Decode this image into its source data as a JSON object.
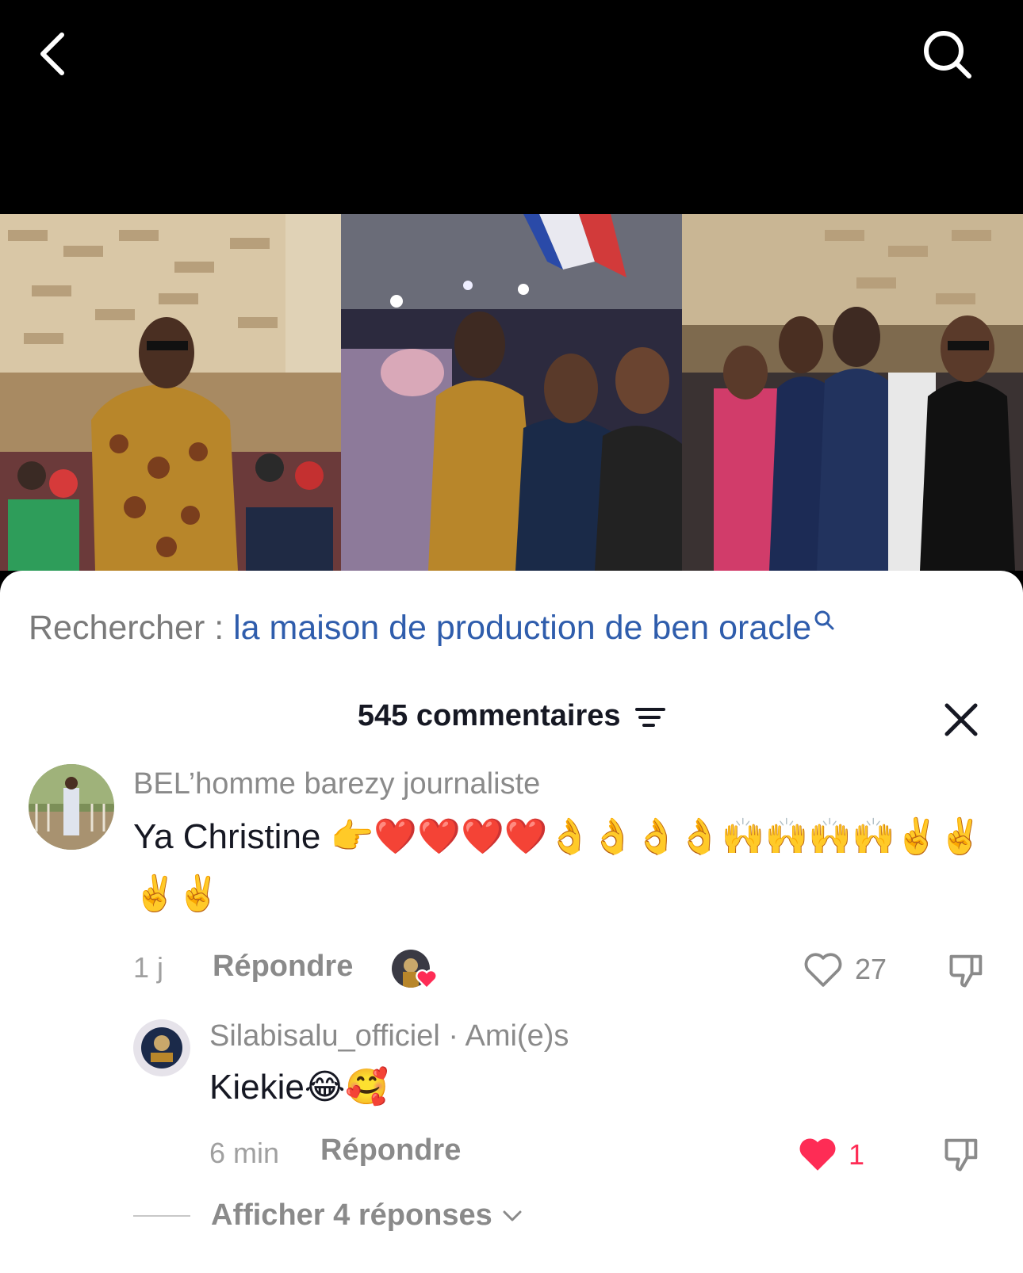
{
  "search_suggestion": {
    "prefix": "Rechercher :",
    "query": "la maison de production de ben oracle"
  },
  "comments_header": {
    "title": "545 commentaires"
  },
  "comments": [
    {
      "username": "BEL’homme barezy journaliste",
      "text": "Ya Christine 👉❤️❤️❤️❤️👌👌👌👌🙌🙌🙌🙌✌️✌️✌️✌️",
      "time": "1 j",
      "reply_label": "Répondre",
      "likes": "27",
      "liked": false
    }
  ],
  "replies": [
    {
      "username": "Silabisalu_officiel",
      "tag": "· Ami(e)s",
      "text": "Kiekie😂🥰",
      "time": "6 min",
      "reply_label": "Répondre",
      "likes": "1",
      "liked": true
    }
  ],
  "view_more_replies": "Afficher 4 réponses",
  "colors": {
    "link_blue": "#2f5dac",
    "like_red": "#fe2c55",
    "text_dark": "#161823",
    "text_grey": "#8a8a8a"
  }
}
